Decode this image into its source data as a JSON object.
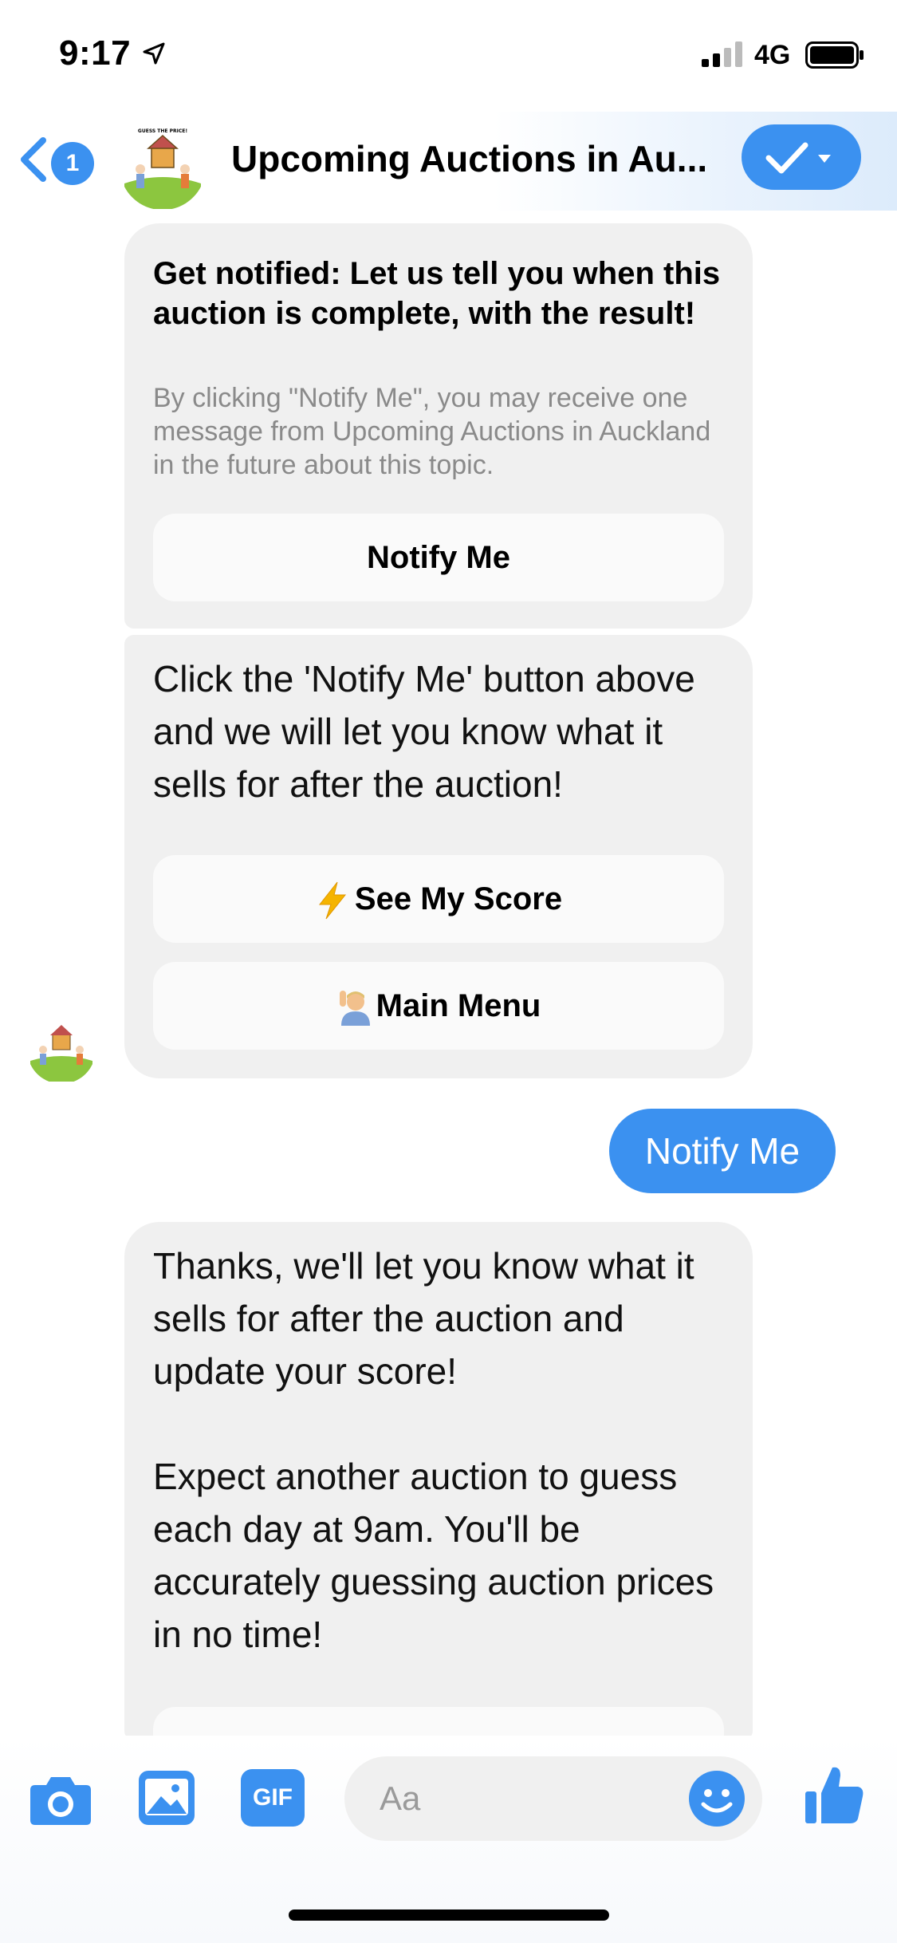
{
  "status_bar": {
    "time": "9:17",
    "network": "4G",
    "location_icon": "location-arrow-icon",
    "signal_icon": "cellular-signal-icon",
    "battery_icon": "battery-icon"
  },
  "header": {
    "back_badge": "1",
    "title": "Upcoming Auctions in Au...",
    "avatar_text": "GUESS THE PRICE!",
    "icons": {
      "back": "chevron-left-icon",
      "done": "checkmark-icon",
      "dropdown": "caret-down-icon"
    }
  },
  "messages": {
    "card1": {
      "title": "Get notified: Let us tell you when this auction is complete, with the result!",
      "subtitle": "By clicking \"Notify Me\", you may receive one message from Upcoming Auctions in Auckland in the future about this topic.",
      "button": "Notify Me"
    },
    "card2": {
      "text": "Click the 'Notify Me' button above and we will let you know what it sells for after the auction!",
      "score_button": "See My Score",
      "menu_button": "Main Menu"
    },
    "sent": {
      "text": "Notify Me"
    },
    "card3": {
      "paragraph1": "Thanks, we'll let you know what it sells for after the auction and update your score!",
      "paragraph2": "Expect another auction to guess each day at 9am. You'll be accurately guessing auction prices in no time!"
    }
  },
  "composer": {
    "placeholder": "Aa",
    "gif_label": "GIF",
    "icons": {
      "camera": "camera-icon",
      "image": "image-icon",
      "emoji": "emoji-icon",
      "like": "thumbs-up-icon"
    }
  },
  "colors": {
    "accent": "#3b91f0",
    "bubble": "#f0f0f0",
    "subtext": "#8a8a8a"
  }
}
